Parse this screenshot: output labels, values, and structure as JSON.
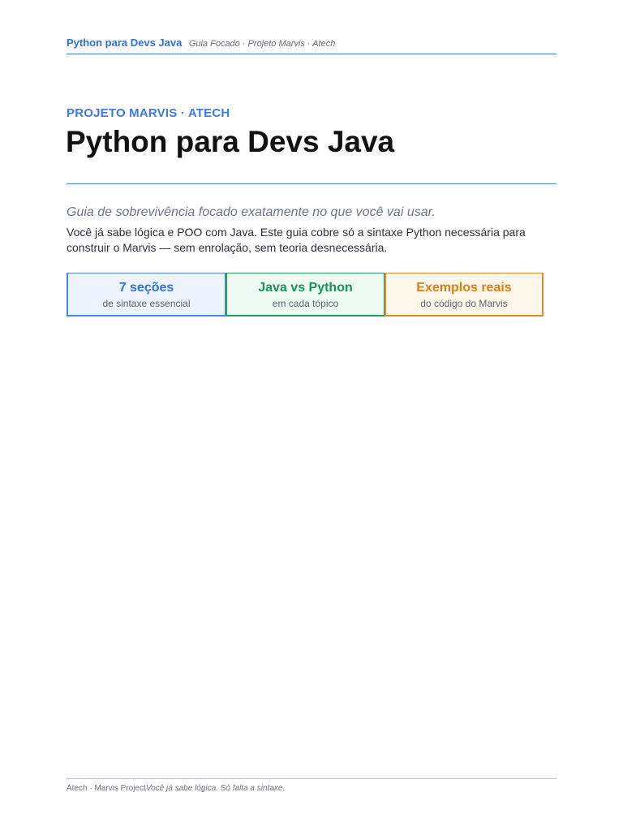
{
  "header": {
    "brand": "Python para Devs Java",
    "subtitle": "Guia Focado · Projeto Marvis · Atech"
  },
  "hero": {
    "eyebrow": "PROJETO MARVIS · ATECH",
    "title": "Python para Devs Java"
  },
  "intro": {
    "lead": "Guia de sobrevivência focado exatamente no que você vai usar.",
    "body": "Você já sabe lógica e POO com Java. Este guia cobre só a sintaxe Python necessária para construir o Marvis — sem enrolação, sem teoria desnecessária."
  },
  "cards": [
    {
      "title": "7 seções",
      "subtitle": "de sintaxe essencial",
      "color": "#2f6fe0"
    },
    {
      "title": "Java vs Python",
      "subtitle": "em cada tópico",
      "color": "#18935a"
    },
    {
      "title": "Exemplos reais",
      "subtitle": "do código do Marvis",
      "color": "#df7d10"
    }
  ],
  "footer": {
    "left": "Atech · Marvis Project",
    "tagline": "Você já sabe lógica. Só falta a sintaxe."
  }
}
